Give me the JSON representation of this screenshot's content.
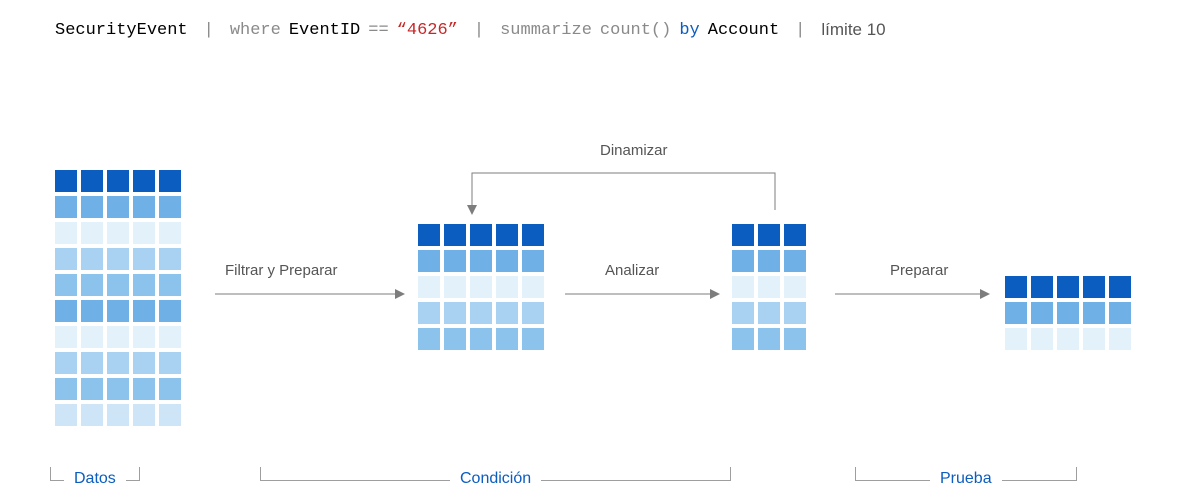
{
  "query": {
    "table": "SecurityEvent",
    "pipe": "|",
    "where": "where",
    "field": "EventID",
    "op": "==",
    "value": "“4626”",
    "summarize": "summarize",
    "countfn": "count()",
    "by": "by",
    "account": "Account",
    "limit": "límite 10"
  },
  "annotations": {
    "filter_prepare": "Filtrar y   Preparar",
    "analyze": "Analizar",
    "prepare2": "Preparar",
    "pivot": "Dinamizar"
  },
  "sections": {
    "data": "Datos",
    "condition": "Condición",
    "evidence": "Prueba"
  },
  "grids": {
    "g1": {
      "cols": 5,
      "rows": 10,
      "pattern": [
        "dark",
        "med2",
        "pale",
        "med1",
        "mid",
        "med2",
        "pale",
        "med1",
        "mid",
        "near"
      ]
    },
    "g2": {
      "cols": 5,
      "rows": 5,
      "pattern": [
        "dark",
        "med2",
        "pale",
        "med1",
        "mid"
      ]
    },
    "g3": {
      "cols": 3,
      "rows": 5,
      "pattern": [
        "dark",
        "med2",
        "pale",
        "med1",
        "mid"
      ]
    },
    "g4": {
      "cols": 5,
      "rows": 3,
      "pattern": [
        "dark",
        "med2",
        "pale"
      ]
    }
  }
}
